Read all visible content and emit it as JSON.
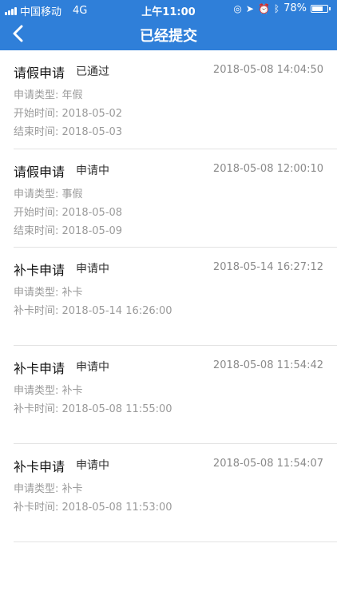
{
  "status_bar": {
    "carrier": "中国移动",
    "network": "4G",
    "time": "上午11:00",
    "battery": "78%",
    "battery_level": 0.78
  },
  "nav": {
    "title": "已经提交",
    "back_icon": "chevron-left-icon"
  },
  "colors": {
    "header_bg": "#2f7fd9"
  },
  "items": [
    {
      "title": "请假申请",
      "status": "已通过",
      "timestamp": "2018-05-08 14:04:50",
      "details": [
        "申请类型: 年假",
        "开始时间: 2018-05-02",
        "结束时间: 2018-05-03"
      ]
    },
    {
      "title": "请假申请",
      "status": "申请中",
      "timestamp": "2018-05-08 12:00:10",
      "details": [
        "申请类型: 事假",
        "开始时间: 2018-05-08",
        "结束时间: 2018-05-09"
      ]
    },
    {
      "title": "补卡申请",
      "status": "申请中",
      "timestamp": "2018-05-14 16:27:12",
      "details": [
        "申请类型: 补卡",
        "补卡时间: 2018-05-14 16:26:00"
      ]
    },
    {
      "title": "补卡申请",
      "status": "申请中",
      "timestamp": "2018-05-08 11:54:42",
      "details": [
        "申请类型: 补卡",
        "补卡时间: 2018-05-08 11:55:00"
      ]
    },
    {
      "title": "补卡申请",
      "status": "申请中",
      "timestamp": "2018-05-08 11:54:07",
      "details": [
        "申请类型: 补卡",
        "补卡时间: 2018-05-08 11:53:00"
      ]
    }
  ]
}
